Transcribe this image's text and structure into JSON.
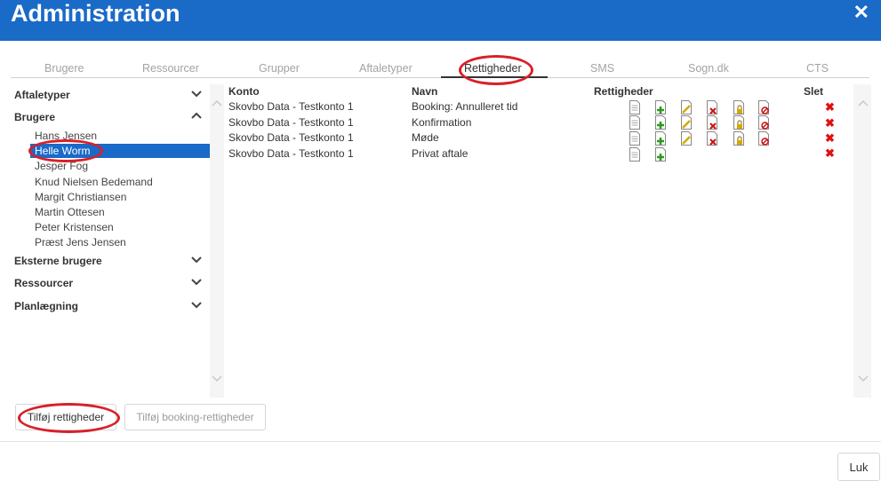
{
  "window": {
    "title": "Administration",
    "close_symbol": "✕"
  },
  "tabs": [
    {
      "label": "Brugere"
    },
    {
      "label": "Ressourcer"
    },
    {
      "label": "Grupper"
    },
    {
      "label": "Aftaletyper"
    },
    {
      "label": "Rettigheder",
      "active": true
    },
    {
      "label": "SMS"
    },
    {
      "label": "Sogn.dk"
    },
    {
      "label": "CTS"
    }
  ],
  "sidebar": {
    "groups": [
      {
        "label": "Aftaletyper",
        "expanded": false
      },
      {
        "label": "Brugere",
        "expanded": true
      },
      {
        "label": "Eksterne brugere",
        "expanded": false
      },
      {
        "label": "Ressourcer",
        "expanded": false
      },
      {
        "label": "Planlægning",
        "expanded": false
      }
    ],
    "users": [
      "Hans Jensen",
      "Helle Worm",
      "Jesper Fog",
      "Knud Nielsen Bedemand",
      "Margit Christiansen",
      "Martin Ottesen",
      "Peter Kristensen",
      "Præst Jens Jensen"
    ],
    "selected_user": "Helle Worm"
  },
  "table": {
    "headers": {
      "konto": "Konto",
      "navn": "Navn",
      "rettigheder": "Rettigheder",
      "slet": "Slet"
    },
    "rows": [
      {
        "konto": "Skovbo Data - Testkonto 1",
        "navn": "Booking: Annulleret tid",
        "icons": [
          "doc-icon",
          "add-doc-icon",
          "edit-doc-icon",
          "delete-doc-icon",
          "lock-doc-icon",
          "block-doc-icon"
        ]
      },
      {
        "konto": "Skovbo Data - Testkonto 1",
        "navn": "Konfirmation",
        "icons": [
          "doc-icon",
          "add-doc-icon",
          "edit-doc-icon",
          "delete-doc-icon",
          "lock-doc-icon",
          "block-doc-icon"
        ]
      },
      {
        "konto": "Skovbo Data - Testkonto 1",
        "navn": "Møde",
        "icons": [
          "doc-icon",
          "add-doc-icon",
          "edit-doc-icon",
          "delete-doc-icon",
          "lock-doc-icon",
          "block-doc-icon"
        ]
      },
      {
        "konto": "Skovbo Data - Testkonto 1",
        "navn": "Privat aftale",
        "icons": [
          "doc-icon",
          "add-doc-icon"
        ]
      }
    ],
    "delete_symbol": "✖"
  },
  "buttons": {
    "add_rights": "Tilføj rettigheder",
    "add_booking_rights": "Tilføj booking-rettigheder",
    "close": "Luk"
  },
  "colors": {
    "accent": "#1a6ac8",
    "delete": "#e01010",
    "annotation": "#d8202a"
  }
}
